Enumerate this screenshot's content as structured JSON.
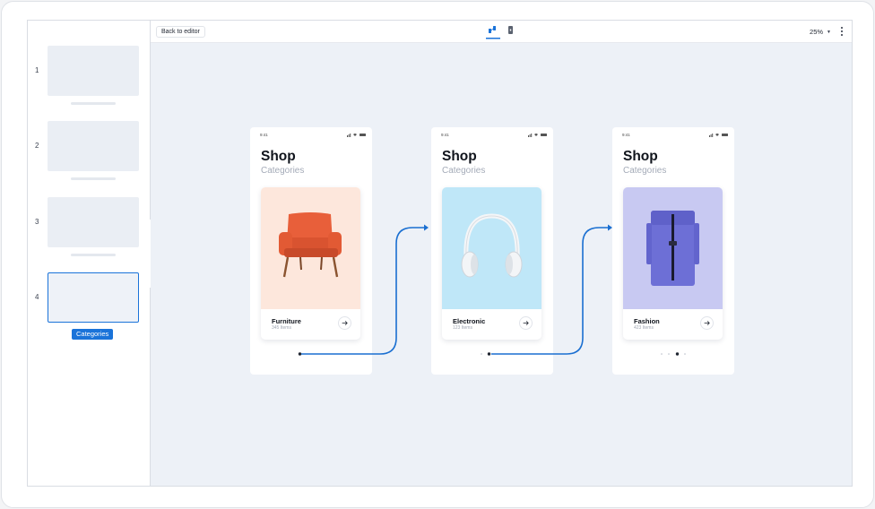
{
  "toolbar": {
    "back_label": "Back to editor",
    "zoom_label": "25%",
    "view_icons": [
      "flow-view-icon",
      "device-view-icon"
    ],
    "active_view": "flow-view-icon"
  },
  "sidebar": {
    "slides": [
      {
        "number": "1",
        "label": ""
      },
      {
        "number": "2",
        "label": ""
      },
      {
        "number": "3",
        "label": ""
      },
      {
        "number": "4",
        "label": "Categories"
      }
    ],
    "selected_index": 3,
    "collapse_icon": "chevron-left-icon"
  },
  "phones": [
    {
      "time": "9:41",
      "title": "Shop",
      "subtitle": "Categories",
      "card": {
        "name": "Furniture",
        "count": "345 Items",
        "image": "armchair",
        "bg": "#fde7dc"
      },
      "active_dot": 0
    },
    {
      "time": "9:41",
      "title": "Shop",
      "subtitle": "Categories",
      "card": {
        "name": "Electronic",
        "count": "123 Items",
        "image": "headphones",
        "bg": "#bfe7f8"
      },
      "active_dot": 1
    },
    {
      "time": "9:41",
      "title": "Shop",
      "subtitle": "Categories",
      "card": {
        "name": "Fashion",
        "count": "423 Items",
        "image": "backpack",
        "bg": "#c8c9f2"
      },
      "active_dot": 2
    }
  ],
  "colors": {
    "accent": "#1a73d9",
    "canvas": "#edf1f7",
    "link": "#1a6fd1"
  }
}
